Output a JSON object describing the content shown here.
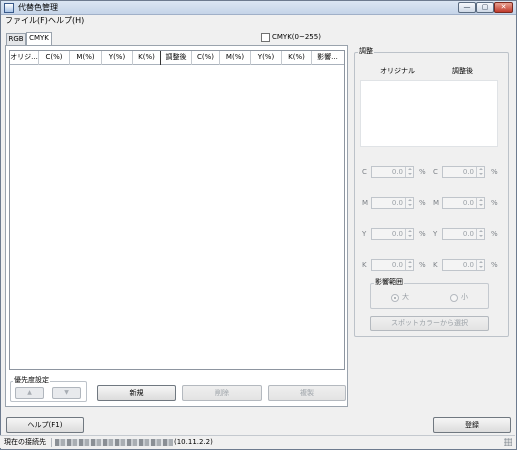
{
  "window": {
    "title": "代替色管理",
    "controls": {
      "minimize": "—",
      "maximize": "▢",
      "close": "✕"
    }
  },
  "menu": {
    "file": "ファイル(F)",
    "help": "ヘルプ(H)"
  },
  "tabs": [
    {
      "label": "RGB"
    },
    {
      "label": "CMYK"
    }
  ],
  "cmyk_range_checkbox": {
    "label": "CMYK(0~255)",
    "checked": false
  },
  "table": {
    "columns": [
      "オリジ...",
      "C(%)",
      "M(%)",
      "Y(%)",
      "K(%)",
      "調整後",
      "C(%)",
      "M(%)",
      "Y(%)",
      "K(%)",
      "影響..."
    ],
    "rows": []
  },
  "priority": {
    "label": "優先度設定",
    "up": "▲",
    "down": "▼"
  },
  "buttons": {
    "new": "新規",
    "delete": "削除",
    "copy": "複製",
    "help": "ヘルプ(F1)",
    "register": "登録",
    "spot_color": "スポットカラーから選択"
  },
  "adjust": {
    "label": "調整",
    "original_header": "オリジナル",
    "adjusted_header": "調整後",
    "rows": [
      {
        "letter": "C",
        "original": "0.0",
        "adjusted": "0.0",
        "unit": "%"
      },
      {
        "letter": "M",
        "original": "0.0",
        "adjusted": "0.0",
        "unit": "%"
      },
      {
        "letter": "Y",
        "original": "0.0",
        "adjusted": "0.0",
        "unit": "%"
      },
      {
        "letter": "K",
        "original": "0.0",
        "adjusted": "0.0",
        "unit": "%"
      }
    ],
    "range": {
      "label": "影響範囲",
      "large": "大",
      "small": "小",
      "selected": "large"
    }
  },
  "status": {
    "label": "現在の接続先",
    "ip": "(10.11.2.2)"
  }
}
